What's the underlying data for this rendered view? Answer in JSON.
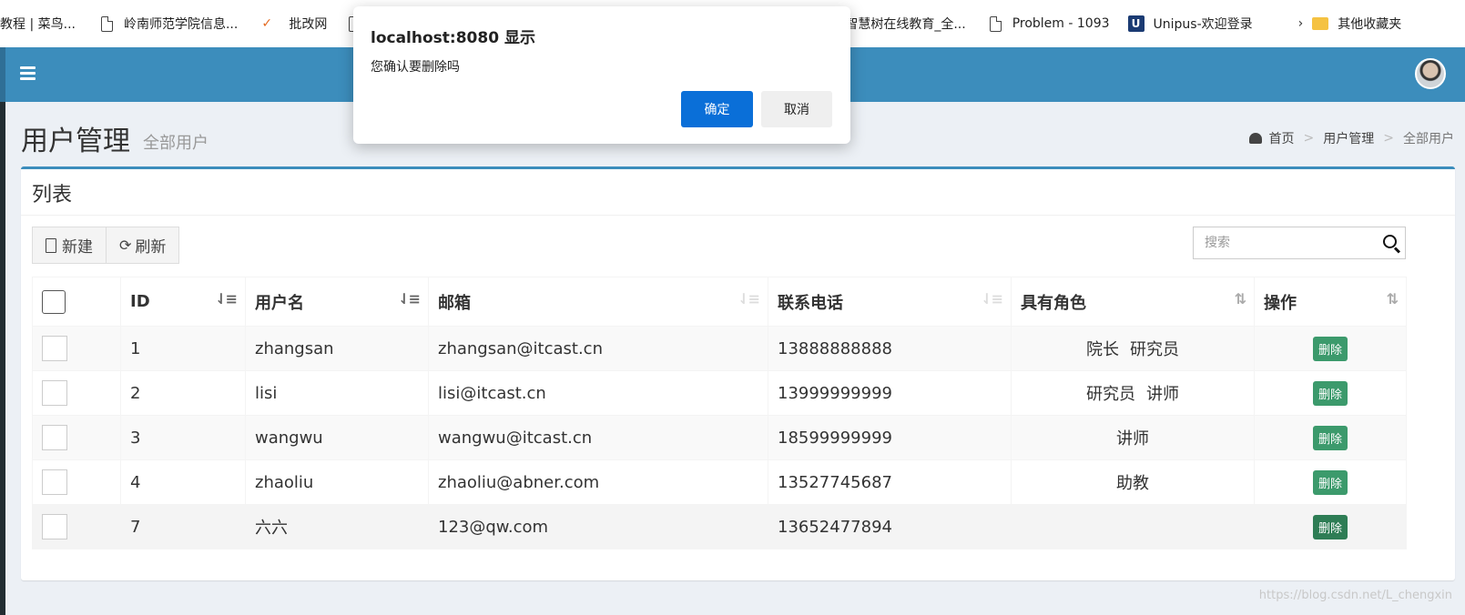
{
  "bookmarks": {
    "items": [
      {
        "label": "教程 | 菜鸟..."
      },
      {
        "label": "岭南师范学院信息..."
      },
      {
        "label": "批改网"
      },
      {
        "label": "智慧树在线教育_全..."
      },
      {
        "label": "Problem - 1093"
      },
      {
        "label": "Unipus-欢迎登录"
      },
      {
        "label": "其他收藏夹"
      }
    ],
    "more_glyph": "›"
  },
  "header": {
    "title": "用户管理",
    "subtitle": "全部用户",
    "breadcrumb": [
      "首页",
      "用户管理",
      "全部用户"
    ],
    "breadcrumb_sep": ">"
  },
  "box": {
    "title": "列表",
    "toolbar": {
      "new_label": "新建",
      "refresh_label": "刷新"
    },
    "search": {
      "placeholder": "搜索"
    }
  },
  "table": {
    "columns": [
      "ID",
      "用户名",
      "邮箱",
      "联系电话",
      "具有角色",
      "操作"
    ],
    "rows": [
      {
        "id": "1",
        "username": "zhangsan",
        "email": "zhangsan@itcast.cn",
        "phone": "13888888888",
        "roles": [
          "院长",
          "研究员"
        ],
        "action": "删除"
      },
      {
        "id": "2",
        "username": "lisi",
        "email": "lisi@itcast.cn",
        "phone": "13999999999",
        "roles": [
          "研究员",
          "讲师"
        ],
        "action": "删除"
      },
      {
        "id": "3",
        "username": "wangwu",
        "email": "wangwu@itcast.cn",
        "phone": "18599999999",
        "roles": [
          "讲师"
        ],
        "action": "删除"
      },
      {
        "id": "4",
        "username": "zhaoliu",
        "email": "zhaoliu@abner.com",
        "phone": "13527745687",
        "roles": [
          "助教"
        ],
        "action": "删除"
      },
      {
        "id": "7",
        "username": "六六",
        "email": "123@qw.com",
        "phone": "13652477894",
        "roles": [],
        "action": "删除"
      }
    ]
  },
  "dialog": {
    "title": "localhost:8080 显示",
    "message": "您确认要删除吗",
    "ok_label": "确定",
    "cancel_label": "取消"
  },
  "watermark": "https://blog.csdn.net/L_chengxin",
  "colors": {
    "navbar": "#3c8dbc",
    "delete_button": "#3c9a6c",
    "dialog_ok": "#0a6fd8"
  }
}
